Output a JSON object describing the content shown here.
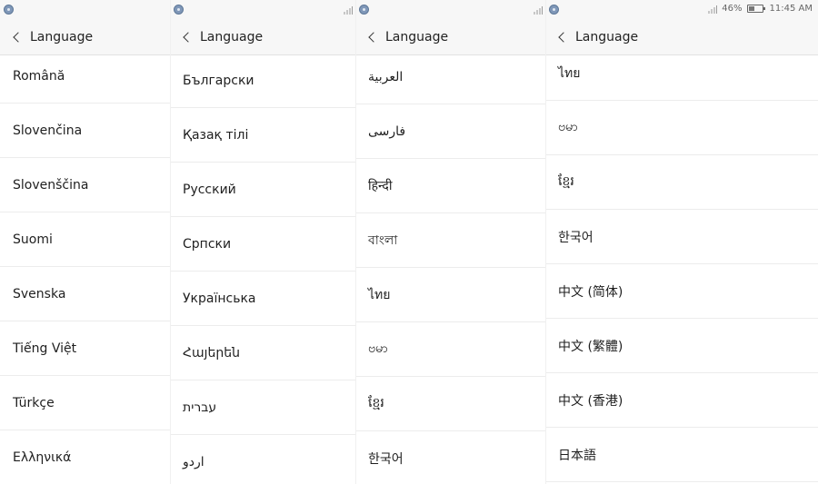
{
  "panels": [
    {
      "header": {
        "title": "Language"
      },
      "languages": [
        "Română",
        "Slovenčina",
        "Slovenščina",
        "Suomi",
        "Svenska",
        "Tiếng Việt",
        "Türkçe",
        "Ελληνικά"
      ]
    },
    {
      "header": {
        "title": "Language"
      },
      "languages": [
        "Български",
        "Қазақ тілі",
        "Русский",
        "Српски",
        "Українська",
        "Հայերեն",
        "עברית",
        "اردو"
      ]
    },
    {
      "header": {
        "title": "Language"
      },
      "languages": [
        "العربية",
        "فارسی",
        "हिन्दी",
        "বাংলা",
        "ไทย",
        "ဗမာ",
        "ខ្មែរ",
        "한국어"
      ]
    },
    {
      "header": {
        "title": "Language"
      },
      "languages": [
        "ไทย",
        "ဗမာ",
        "ខ្មែរ",
        "한국어",
        "中文 (简体)",
        "中文 (繁體)",
        "中文 (香港)",
        "日本語"
      ]
    }
  ],
  "status_bar": {
    "battery_text": "46%",
    "battery_level": 0.46,
    "time": "11:45 AM"
  },
  "icons": {
    "back": "chevron-left-icon",
    "app": "app-notification-icon",
    "signal": "signal-icon",
    "battery": "battery-icon"
  }
}
